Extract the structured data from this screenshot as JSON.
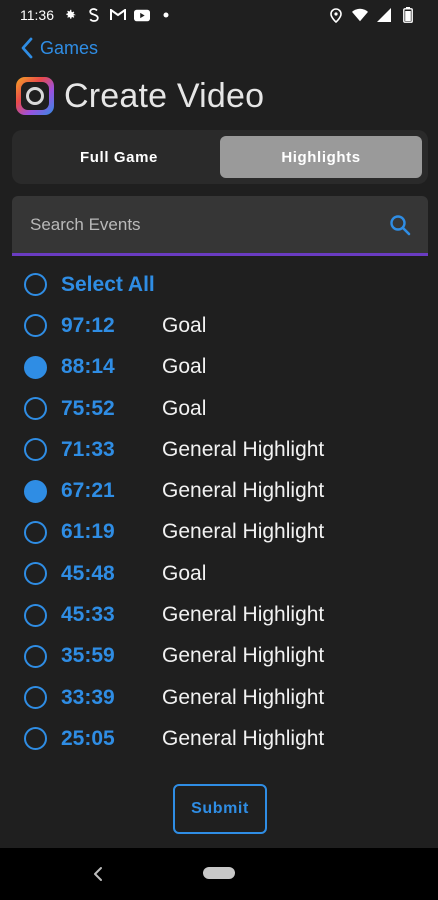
{
  "status_bar": {
    "time": "11:36",
    "left_icons": [
      "gear-icon",
      "s-app-icon",
      "gmail-icon",
      "youtube-icon",
      "dot-icon"
    ],
    "right_icons": [
      "location-icon",
      "wifi-icon",
      "signal-icon",
      "battery-icon"
    ]
  },
  "nav": {
    "back_label": "Games"
  },
  "header": {
    "title": "Create Video"
  },
  "tabs": [
    {
      "label": "Full Game",
      "active": false
    },
    {
      "label": "Highlights",
      "active": true
    }
  ],
  "search": {
    "placeholder": "Search Events",
    "value": ""
  },
  "select_all": {
    "label": "Select All",
    "checked": false
  },
  "events": [
    {
      "time": "97:12",
      "type": "Goal",
      "checked": false
    },
    {
      "time": "88:14",
      "type": "Goal",
      "checked": true
    },
    {
      "time": "75:52",
      "type": "Goal",
      "checked": false
    },
    {
      "time": "71:33",
      "type": "General Highlight",
      "checked": false
    },
    {
      "time": "67:21",
      "type": "General Highlight",
      "checked": true
    },
    {
      "time": "61:19",
      "type": "General Highlight",
      "checked": false
    },
    {
      "time": "45:48",
      "type": "Goal",
      "checked": false
    },
    {
      "time": "45:33",
      "type": "General Highlight",
      "checked": false
    },
    {
      "time": "35:59",
      "type": "General Highlight",
      "checked": false
    },
    {
      "time": "33:39",
      "type": "General Highlight",
      "checked": false
    },
    {
      "time": "25:05",
      "type": "General Highlight",
      "checked": false
    }
  ],
  "submit_label": "Submit",
  "colors": {
    "accent": "#2f8de4",
    "background": "#1f1f1f",
    "tab_active": "#9a9a9a",
    "search_underline": "#6a3cc2"
  }
}
